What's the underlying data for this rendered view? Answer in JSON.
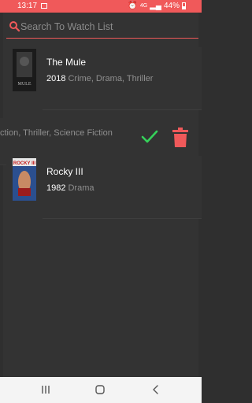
{
  "status_bar": {
    "time": "13:17",
    "network": "4G",
    "battery": "44%"
  },
  "search": {
    "placeholder": "Search To Watch List",
    "value": ""
  },
  "movies": [
    {
      "title": "The Mule",
      "year": "2018",
      "genres": "Crime, Drama, Thriller",
      "poster_text": "MULE"
    },
    {
      "title": "",
      "year": "",
      "genres": "ction, Thriller, Science Fiction",
      "poster_text": ""
    },
    {
      "title": "Rocky III",
      "year": "1982",
      "genres": "Drama",
      "poster_text": "ROCKY III"
    }
  ],
  "swipe_actions": {
    "mark_watched_icon": "check-icon",
    "delete_icon": "trash-icon",
    "check_color": "#35d15a",
    "delete_color": "#f0595a"
  },
  "colors": {
    "accent": "#f0595a",
    "background": "#333333"
  }
}
